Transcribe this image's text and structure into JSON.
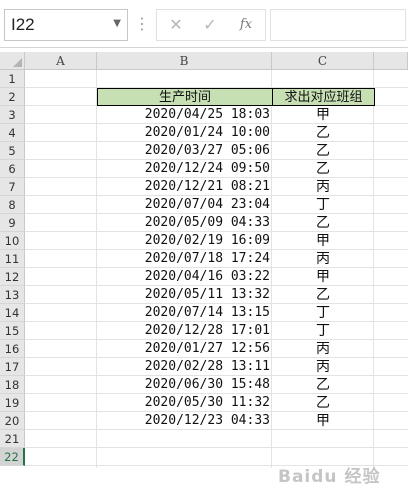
{
  "formula_bar": {
    "name_box": "I22",
    "cancel_icon": "✕",
    "enter_icon": "✓",
    "fx_label": "fx",
    "formula": ""
  },
  "sheet": {
    "columns": [
      "A",
      "B",
      "C"
    ],
    "rows": [
      "1",
      "2",
      "3",
      "4",
      "5",
      "6",
      "7",
      "8",
      "9",
      "10",
      "11",
      "12",
      "13",
      "14",
      "15",
      "16",
      "17",
      "18",
      "19",
      "20",
      "21",
      "22"
    ],
    "selected_row": "22",
    "header_b": "生产时间",
    "header_c": "求出对应班组",
    "records": [
      {
        "time": "2020/04/25 18:03",
        "group": "甲"
      },
      {
        "time": "2020/01/24 10:00",
        "group": "乙"
      },
      {
        "time": "2020/03/27 05:06",
        "group": "乙"
      },
      {
        "time": "2020/12/24 09:50",
        "group": "乙"
      },
      {
        "time": "2020/12/21 08:21",
        "group": "丙"
      },
      {
        "time": "2020/07/04 23:04",
        "group": "丁"
      },
      {
        "time": "2020/05/09 04:33",
        "group": "乙"
      },
      {
        "time": "2020/02/19 16:09",
        "group": "甲"
      },
      {
        "time": "2020/07/18 17:24",
        "group": "丙"
      },
      {
        "time": "2020/04/16 03:22",
        "group": "甲"
      },
      {
        "time": "2020/05/11 13:32",
        "group": "乙"
      },
      {
        "time": "2020/07/14 13:15",
        "group": "丁"
      },
      {
        "time": "2020/12/28 17:01",
        "group": "丁"
      },
      {
        "time": "2020/01/27 12:56",
        "group": "丙"
      },
      {
        "time": "2020/02/28 13:11",
        "group": "丙"
      },
      {
        "time": "2020/06/30 15:48",
        "group": "乙"
      },
      {
        "time": "2020/05/30 11:32",
        "group": "乙"
      },
      {
        "time": "2020/12/23 04:33",
        "group": "甲"
      }
    ],
    "header_fill_color": "#c6e0b4",
    "selection_color": "#217346"
  },
  "watermark": "Baidu 经验"
}
